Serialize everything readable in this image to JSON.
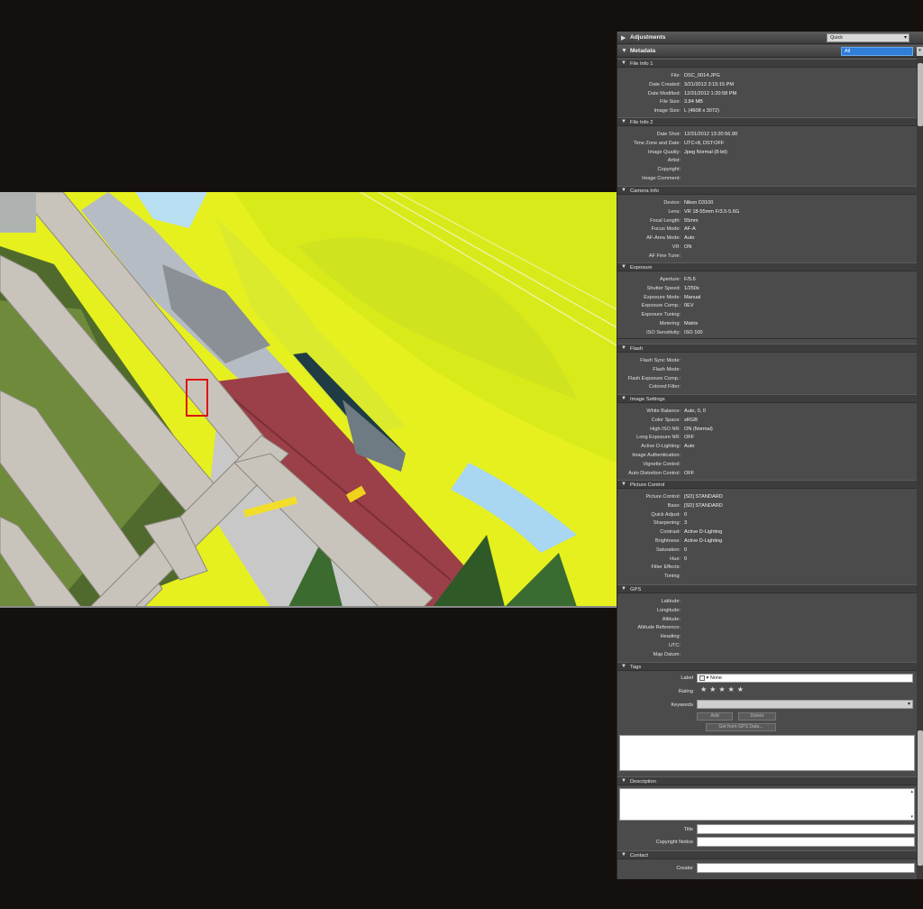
{
  "panel": {
    "adjustments": {
      "title": "Adjustments",
      "mode": "Quick"
    },
    "metadata": {
      "title": "Metadata",
      "filter": "All"
    },
    "file_info_1": {
      "title": "File Info 1",
      "rows": [
        {
          "label": "File:",
          "value": "DSC_0014.JPG"
        },
        {
          "label": "Date Created:",
          "value": "3/21/2013 3:15:15 PM"
        },
        {
          "label": "Date Modified:",
          "value": "12/31/2012 1:20:58 PM"
        },
        {
          "label": "File Size:",
          "value": "3.84 MB"
        },
        {
          "label": "Image Size:",
          "value": "L (4608 x 3072)"
        }
      ]
    },
    "file_info_2": {
      "title": "File Info 2",
      "rows": [
        {
          "label": "Date Shot:",
          "value": "12/31/2012 13:20:56.90"
        },
        {
          "label": "Time Zone and Date:",
          "value": "UTC+8, DST:OFF"
        },
        {
          "label": "Image Quality:",
          "value": "Jpeg Normal (8-bit)"
        },
        {
          "label": "Artist:",
          "value": ""
        },
        {
          "label": "Copyright:",
          "value": ""
        },
        {
          "label": "Image Comment:",
          "value": ""
        }
      ]
    },
    "camera_info": {
      "title": "Camera Info",
      "rows": [
        {
          "label": "Device:",
          "value": "Nikon D3100"
        },
        {
          "label": "Lens:",
          "value": "VR 18-55mm F/3.5-5.6G"
        },
        {
          "label": "Focal Length:",
          "value": "55mm"
        },
        {
          "label": "Focus Mode:",
          "value": "AF-A"
        },
        {
          "label": "AF-Area Mode:",
          "value": "Auto"
        },
        {
          "label": "VR:",
          "value": "ON"
        },
        {
          "label": "AF Fine Tune:",
          "value": ""
        }
      ]
    },
    "exposure": {
      "title": "Exposure",
      "rows": [
        {
          "label": "Aperture:",
          "value": "F/5.6"
        },
        {
          "label": "Shutter Speed:",
          "value": "1/250s"
        },
        {
          "label": "Exposure Mode:",
          "value": "Manual"
        },
        {
          "label": "Exposure Comp.:",
          "value": "0EV"
        },
        {
          "label": "Exposure Tuning:",
          "value": ""
        },
        {
          "label": "Metering:",
          "value": "Matrix"
        },
        {
          "label": "ISO Sensitivity:",
          "value": "ISO 100"
        }
      ]
    },
    "flash": {
      "title": "Flash",
      "rows": [
        {
          "label": "Flash Sync Mode:",
          "value": ""
        },
        {
          "label": "Flash Mode:",
          "value": ""
        },
        {
          "label": "Flash Exposure Comp.:",
          "value": ""
        },
        {
          "label": "Colored Filter:",
          "value": ""
        }
      ]
    },
    "image_settings": {
      "title": "Image Settings",
      "rows": [
        {
          "label": "White Balance:",
          "value": "Auto, 0, 0"
        },
        {
          "label": "Color Space:",
          "value": "sRGB"
        },
        {
          "label": "High ISO NR:",
          "value": "ON (Normal)"
        },
        {
          "label": "Long Exposure NR:",
          "value": "OFF"
        },
        {
          "label": "Active D-Lighting:",
          "value": "Auto"
        },
        {
          "label": "Image Authentication:",
          "value": ""
        },
        {
          "label": "Vignette Control:",
          "value": ""
        },
        {
          "label": "Auto Distortion Control:",
          "value": "OFF"
        }
      ]
    },
    "picture_control": {
      "title": "Picture Control",
      "rows": [
        {
          "label": "Picture Control:",
          "value": "[SD] STANDARD"
        },
        {
          "label": "Base:",
          "value": "[SD] STANDARD"
        },
        {
          "label": "Quick Adjust:",
          "value": "0"
        },
        {
          "label": "Sharpening:",
          "value": "3"
        },
        {
          "label": "Contrast:",
          "value": "Active D-Lighting"
        },
        {
          "label": "Brightness:",
          "value": "Active D-Lighting"
        },
        {
          "label": "Saturation:",
          "value": "0"
        },
        {
          "label": "Hue:",
          "value": "0"
        },
        {
          "label": "Filter Effects:",
          "value": ""
        },
        {
          "label": "Toning:",
          "value": ""
        }
      ]
    },
    "gps": {
      "title": "GPS",
      "rows": [
        {
          "label": "Latitude:",
          "value": ""
        },
        {
          "label": "Longitude:",
          "value": ""
        },
        {
          "label": "Altitude:",
          "value": ""
        },
        {
          "label": "Altitude Reference:",
          "value": ""
        },
        {
          "label": "Heading:",
          "value": ""
        },
        {
          "label": "UTC:",
          "value": ""
        },
        {
          "label": "Map Datum:",
          "value": ""
        }
      ]
    },
    "tags": {
      "title": "Tags",
      "label_label": "Label",
      "label_value": "None",
      "rating_label": "Rating",
      "stars": 5,
      "keywords_label": "Keywords",
      "add_button": "Add",
      "delete_button": "Delete",
      "gps_button": "Get from GPS Data..."
    },
    "description": {
      "title": "Description",
      "title_label": "Title",
      "copyright_label": "Copyright Notice"
    },
    "contact": {
      "title": "Contact",
      "creator_label": "Creator"
    }
  }
}
